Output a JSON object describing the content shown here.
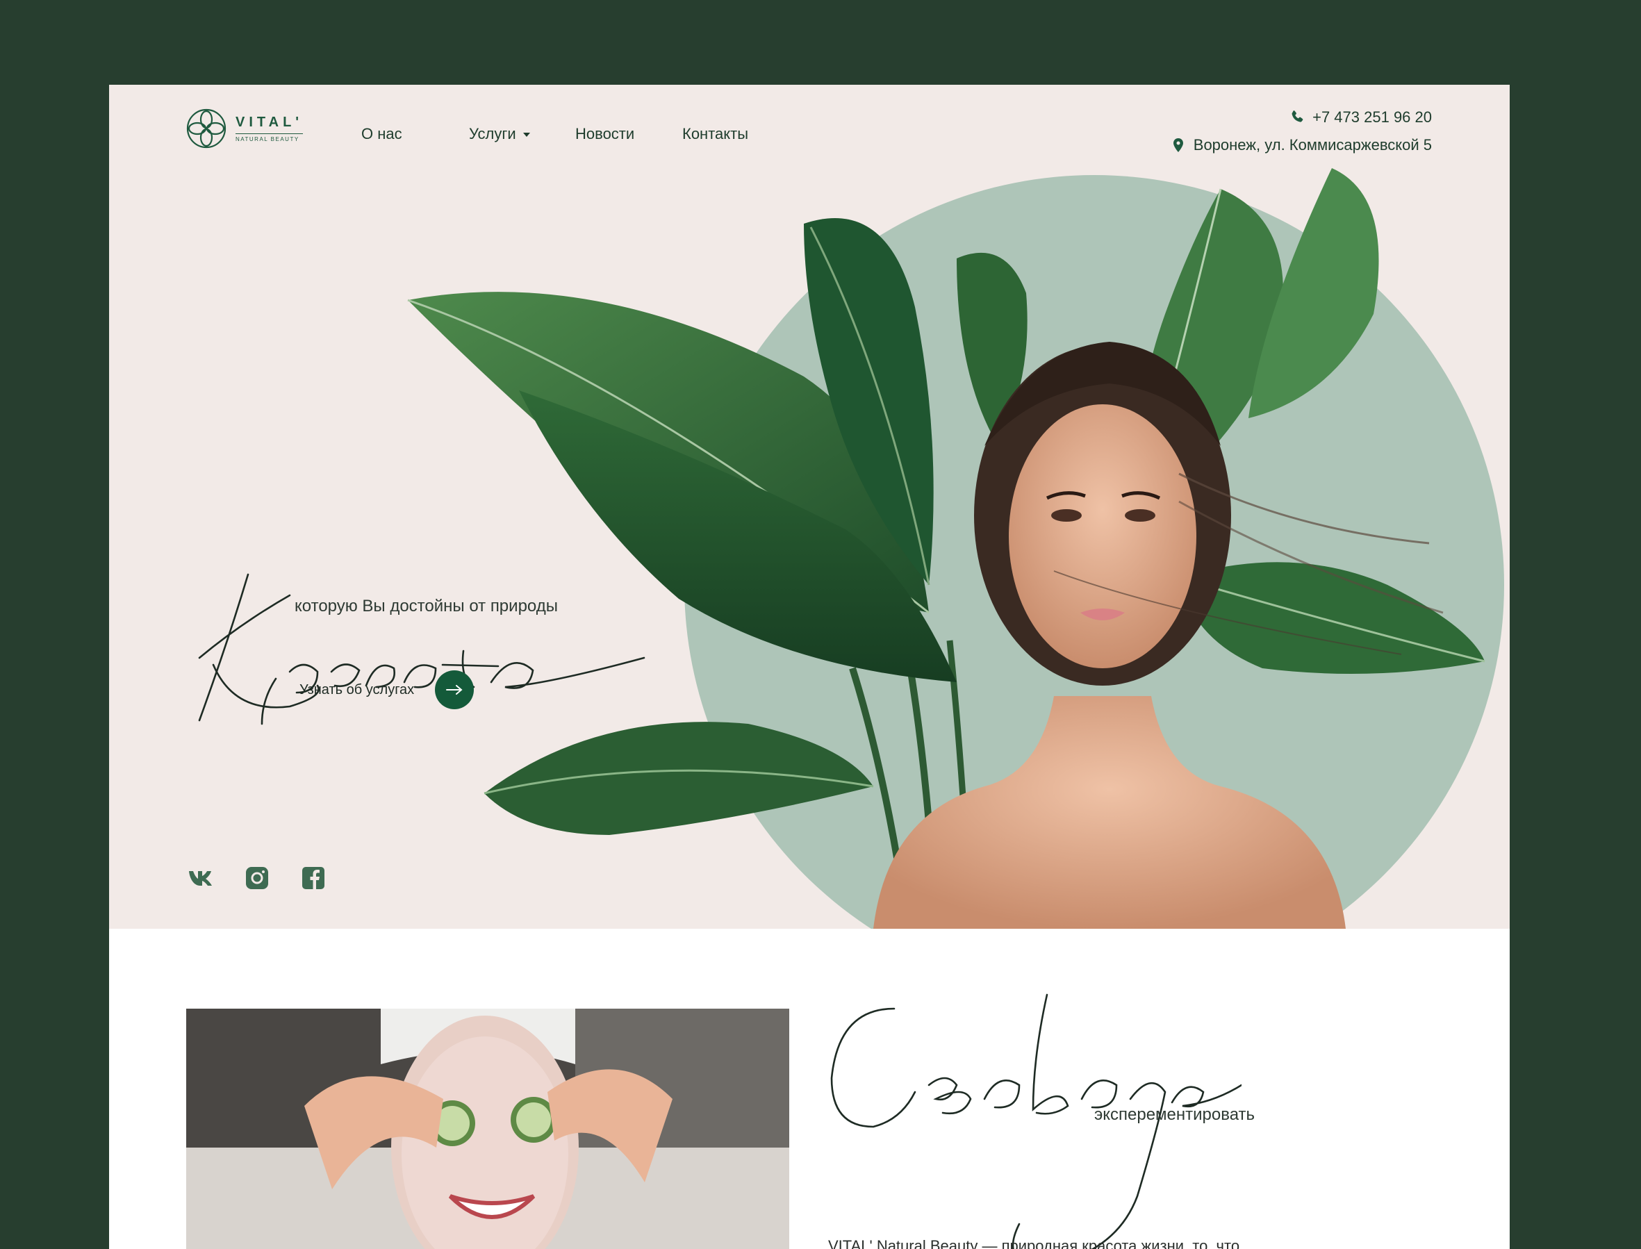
{
  "brand": {
    "name": "VITAL'",
    "tagline": "NATURAL BEAUTY",
    "color": "#1f5a3f"
  },
  "nav": {
    "items": [
      {
        "label": "О нас"
      },
      {
        "label": "Услуги",
        "has_dropdown": true
      },
      {
        "label": "Новости"
      },
      {
        "label": "Контакты"
      }
    ]
  },
  "contact": {
    "phone": "+7 473 251 96 20",
    "address": "Воронеж, ул. Коммисаржевской 5",
    "phone_icon": "phone-icon",
    "address_icon": "map-pin-icon"
  },
  "hero": {
    "script_title": "Красота",
    "subtitle": "которую Вы достойны от природы",
    "cta_label": "Узнать об услугах",
    "cta_icon": "arrow-right-icon",
    "background": "#f2eae7",
    "circle_color": "#aec5b8"
  },
  "socials": [
    {
      "name": "vk",
      "icon": "vk-icon"
    },
    {
      "name": "instagram",
      "icon": "instagram-icon"
    },
    {
      "name": "facebook",
      "icon": "facebook-icon"
    }
  ],
  "section2": {
    "script_title": "Свобода",
    "subtitle": "эксперементировать",
    "paragraph": "VITAL' Natural Beauty — природная красота жизни, то, что"
  },
  "colors": {
    "outer_bg": "#273e2f",
    "accent": "#145a3a",
    "text_dark": "#1e3c2c"
  }
}
